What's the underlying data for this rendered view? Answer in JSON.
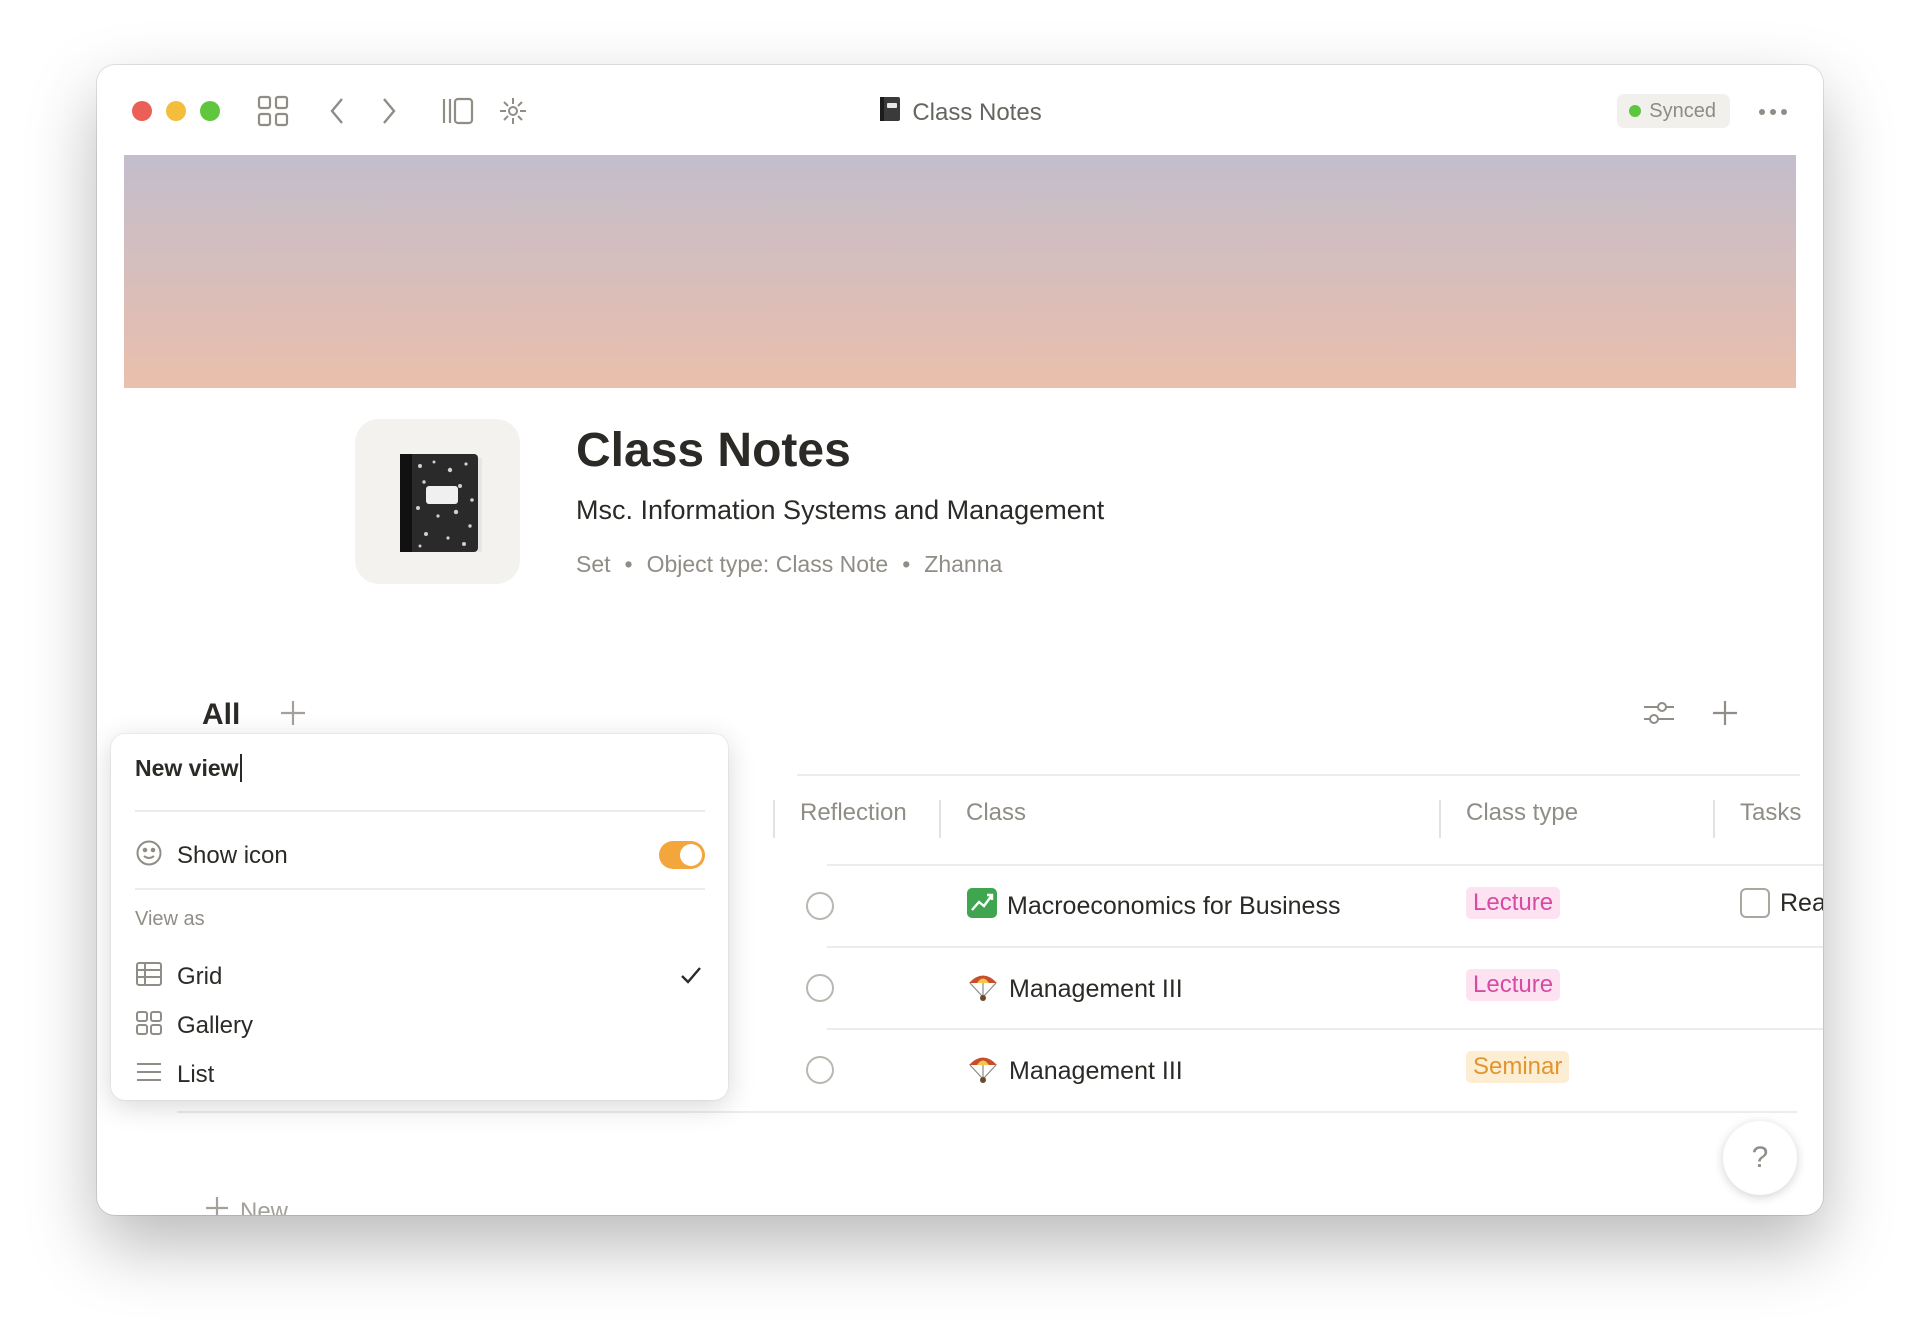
{
  "window": {
    "title": "Class Notes",
    "sync_status": "Synced"
  },
  "page": {
    "title": "Class Notes",
    "description": "Msc. Information Systems and Management",
    "meta": [
      "Set",
      "Object type: Class Note",
      "Zhanna"
    ]
  },
  "views": {
    "active": "All"
  },
  "table": {
    "headers": [
      "Reflection",
      "Class",
      "Class type",
      "Tasks"
    ],
    "rows": [
      {
        "class": "Macroeconomics for Business",
        "class_icon": "chart-icon",
        "type": "Lecture",
        "task": "Rea"
      },
      {
        "class": "Management III",
        "class_icon": "parachute-icon",
        "type": "Lecture",
        "task": ""
      },
      {
        "class": "Management III",
        "class_icon": "parachute-icon",
        "type": "Seminar",
        "task": ""
      }
    ],
    "new_label": "New"
  },
  "popup": {
    "name_value": "New view",
    "show_icon_label": "Show icon",
    "show_icon_on": true,
    "view_as_label": "View as",
    "options": [
      {
        "label": "Grid",
        "icon": "grid-icon",
        "selected": true
      },
      {
        "label": "Gallery",
        "icon": "gallery-icon",
        "selected": false
      },
      {
        "label": "List",
        "icon": "list-icon",
        "selected": false
      }
    ]
  },
  "help": {
    "label": "?"
  },
  "colors": {
    "accent": "#f3a63b",
    "lecture_text": "#d84aa3",
    "lecture_bg": "#fde2f1",
    "seminar_text": "#e0962e",
    "seminar_bg": "#fdedd2",
    "synced_dot": "#5dc540"
  }
}
